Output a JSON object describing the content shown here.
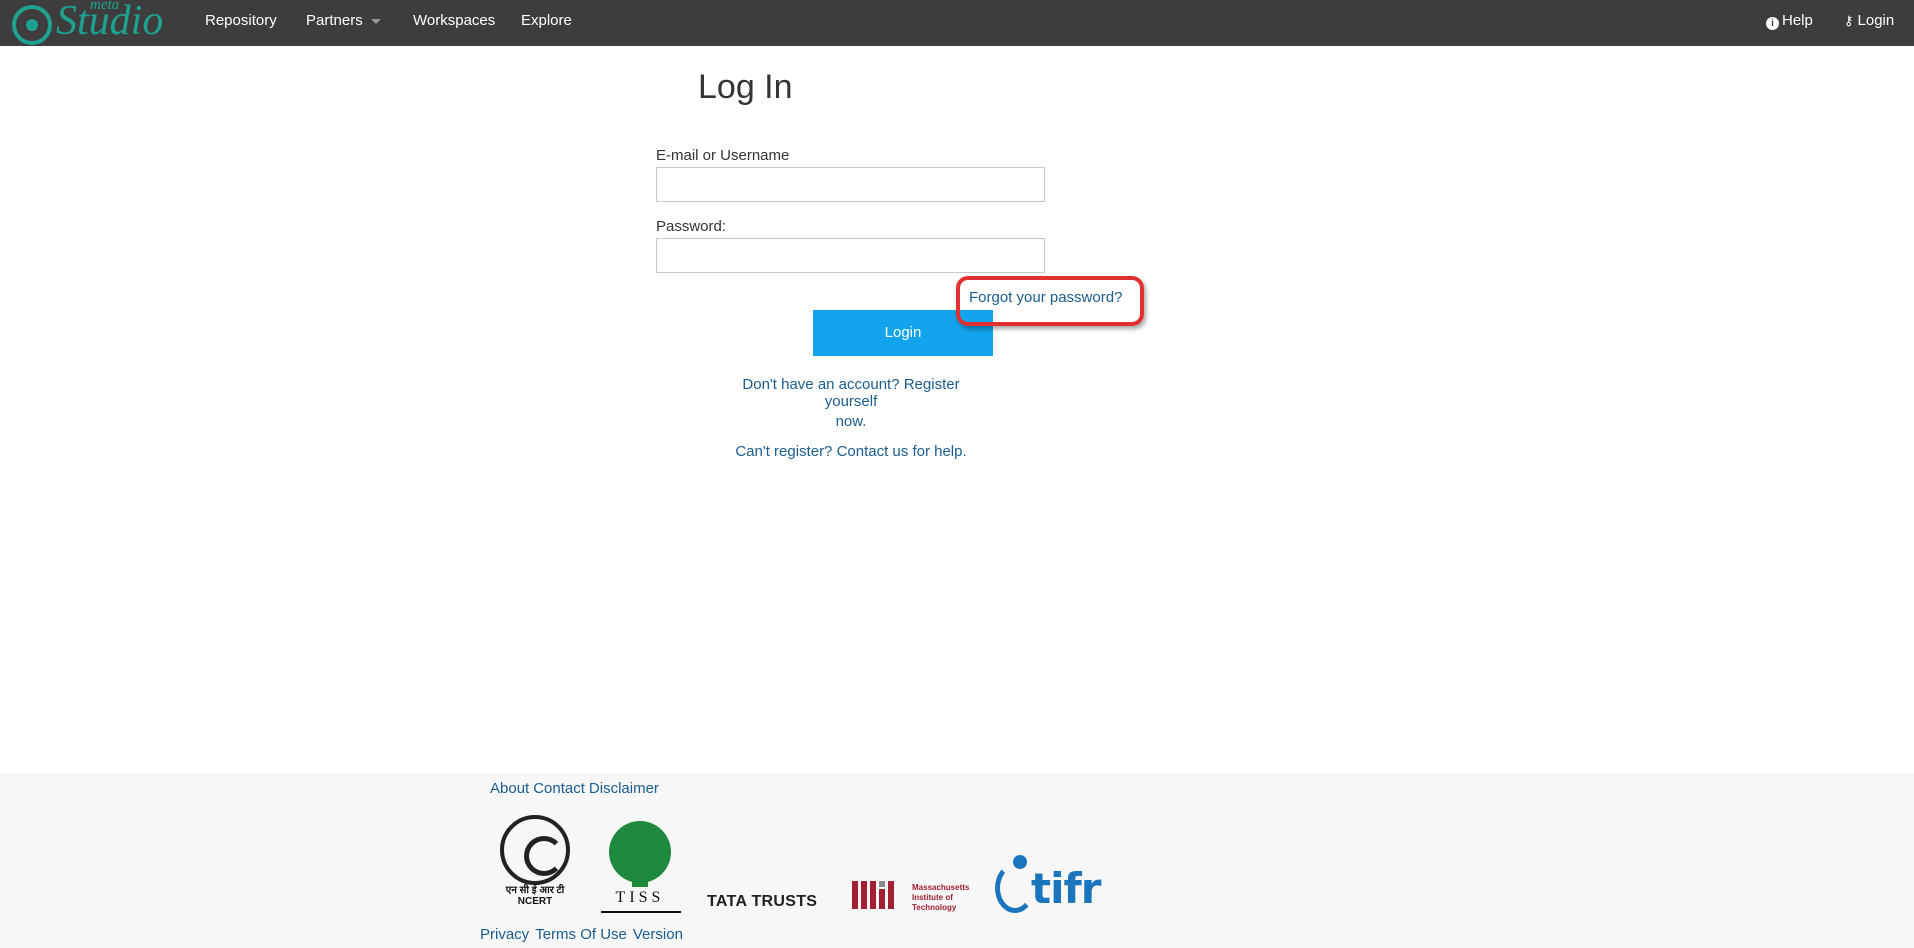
{
  "brand": {
    "meta": "meta",
    "name": "Studio",
    "color": "#1fa18f"
  },
  "nav": {
    "repository": "Repository",
    "partners": "Partners",
    "workspaces": "Workspaces",
    "explore": "Explore",
    "help": "Help",
    "login": "Login"
  },
  "login_form": {
    "title": "Log In",
    "username_label": "E-mail or Username",
    "username_value": "",
    "password_label": "Password:",
    "password_value": "",
    "forgot_link": "Forgot your password?",
    "login_button": "Login",
    "register_line1": "Don't have an account? Register yourself",
    "register_line2": "now.",
    "contact_link": "Can't register? Contact us for help."
  },
  "footer": {
    "top_links": [
      "About",
      "Contact",
      "Disclaimer"
    ],
    "bottom_links": [
      "Privacy",
      "Terms Of Use",
      "Version"
    ],
    "logos": {
      "ncert_text": "एन सी ई आर टी",
      "ncert_text2": "NCERT",
      "tiss_text": "TISS",
      "tata_text": "TATA TRUSTS",
      "mit_line1": "Massachusetts",
      "mit_line2": "Institute of",
      "mit_line3": "Technology",
      "tifr_text": "tifr"
    }
  },
  "colors": {
    "navbar_bg": "#3d3d3d",
    "button_bg": "#12a5ee",
    "link": "#1a5d8f",
    "highlight": "#e0302f"
  }
}
